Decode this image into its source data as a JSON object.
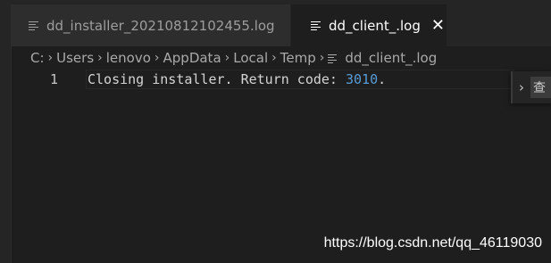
{
  "tabs": [
    {
      "label": "dd_installer_20210812102455.log",
      "active": false
    },
    {
      "label": "dd_client_.log",
      "active": true
    }
  ],
  "breadcrumb": {
    "items": [
      "C:",
      "Users",
      "lenovo",
      "AppData",
      "Local",
      "Temp"
    ],
    "file": "dd_client_.log",
    "separator": "›"
  },
  "editor": {
    "line_number": "1",
    "text_prefix": "Closing installer. Return code: ",
    "return_code": "3010",
    "text_suffix": "."
  },
  "find_widget": {
    "toggle_glyph": "›",
    "input_text": "查"
  },
  "watermark": "https://blog.csdn.net/qq_46119030",
  "colors": {
    "background": "#1e1e1e",
    "tab_inactive": "#2d2d2d",
    "number": "#569cd6"
  },
  "icons": {
    "tab_file": "file-lines-icon",
    "close": "close-icon",
    "chevron": "chevron-right-icon"
  }
}
